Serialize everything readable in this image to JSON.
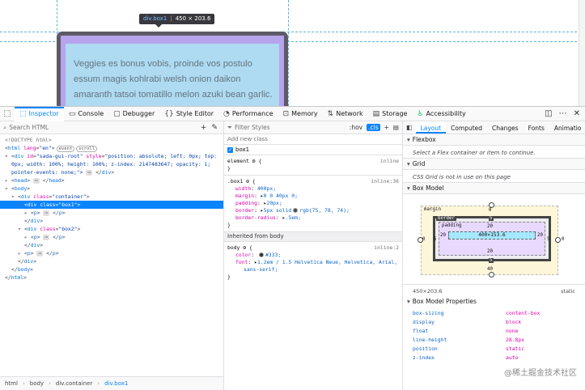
{
  "viewport": {
    "paragraph_text": "Veggies es bonus vobis, proinde vos postulo essum magis kohlrabi welsh onion daikon amaranth tatsoi tomatillo melon azuki bean garlic.",
    "tooltip_tag": "div.box1",
    "tooltip_size": "450 × 203.6"
  },
  "toolbar": {
    "tabs": [
      {
        "label": "Inspector",
        "icon": "inspector-icon"
      },
      {
        "label": "Console",
        "icon": "console-icon"
      },
      {
        "label": "Debugger",
        "icon": "debugger-icon"
      },
      {
        "label": "Style Editor",
        "icon": "style-editor-icon"
      },
      {
        "label": "Performance",
        "icon": "performance-icon"
      },
      {
        "label": "Memory",
        "icon": "memory-icon"
      },
      {
        "label": "Network",
        "icon": "network-icon"
      },
      {
        "label": "Storage",
        "icon": "storage-icon"
      },
      {
        "label": "Accessibility",
        "icon": "accessibility-icon"
      }
    ]
  },
  "markup": {
    "search_placeholder": "Search HTML",
    "lines": {
      "doctype": "<!DOCTYPE html>",
      "html_open_tag": "html",
      "html_attr": "lang",
      "html_val": "\"en\"",
      "html_badge1": "event",
      "html_badge2": "scroll",
      "div_root_attr1": "id",
      "div_root_val1": "\"sada-gui-root\"",
      "div_root_attr2": "style",
      "div_root_val2": "\"position: absolute; left: 0px; top:",
      "div_root_cont1": "0px; width: 100%; height: 100%; z-index: 2147483647; opacity: 1;",
      "div_root_cont2": "pointer-events: none;\">",
      "head": "head",
      "body": "body",
      "container_class": "\"container\"",
      "box1_class": "\"box1\"",
      "box2_class": "\"box2\"",
      "p": "p",
      "div": "div"
    },
    "breadcrumb": [
      "html",
      "body",
      "div.container",
      "div.box1"
    ]
  },
  "rules": {
    "filter_placeholder": "Filter Styles",
    "hov": ":hov",
    "cls": ".cls",
    "add_class_placeholder": "Add new class",
    "class_checkbox_label": "box1",
    "element_selector": "element",
    "element_source": "inline",
    "box1_selector": ".box1",
    "box1_source": "inline:36",
    "box1_decls": [
      {
        "prop": "width",
        "val": "400px;"
      },
      {
        "prop": "margin",
        "val": "0 0 40px 0;"
      },
      {
        "prop": "padding",
        "val": "20px;"
      },
      {
        "prop": "border",
        "val": "5px solid",
        "color": "#4b4e4a",
        "color_text": "rgb(75, 78, 74);"
      },
      {
        "prop": "border-radius",
        "val": ".5em;"
      }
    ],
    "inherited_label": "Inherited from body",
    "body_selector": "body",
    "body_source": "inline:2",
    "body_decls": [
      {
        "prop": "color",
        "val": "#333;",
        "color": "#333333"
      },
      {
        "prop": "font",
        "val": "1.2em / 1.5 Helvetica Neue, Helvetica, Arial,",
        "cont": "sans-serif;"
      }
    ]
  },
  "layout": {
    "tabs": [
      "Layout",
      "Computed",
      "Changes",
      "Fonts",
      "Animatio"
    ],
    "flexbox_title": "Flexbox",
    "flexbox_msg": "Select a Flex container or item to continue.",
    "grid_title": "Grid",
    "grid_msg": "CSS Grid is not in use on this page",
    "box_model_title": "Box Model",
    "box_model": {
      "margin_label": "margin",
      "border_label": "border",
      "padding_label": "padding",
      "content": "400×153.6",
      "margin_top": "0",
      "margin_right": "0",
      "margin_bottom": "40",
      "margin_left": "0",
      "border_top": "5",
      "border_right": "5",
      "border_bottom": "5",
      "border_left": "5",
      "padding_top": "20",
      "padding_right": "20",
      "padding_bottom": "20",
      "padding_left": "20"
    },
    "dims": "450×203.6",
    "position": "static",
    "props_title": "Box Model Properties",
    "props": [
      {
        "k": "box-sizing",
        "v": "content-box"
      },
      {
        "k": "display",
        "v": "block"
      },
      {
        "k": "float",
        "v": "none"
      },
      {
        "k": "line-height",
        "v": "28.8px"
      },
      {
        "k": "position",
        "v": "static"
      },
      {
        "k": "z-index",
        "v": "auto"
      }
    ]
  },
  "watermark": "@稀土掘金技术社区"
}
